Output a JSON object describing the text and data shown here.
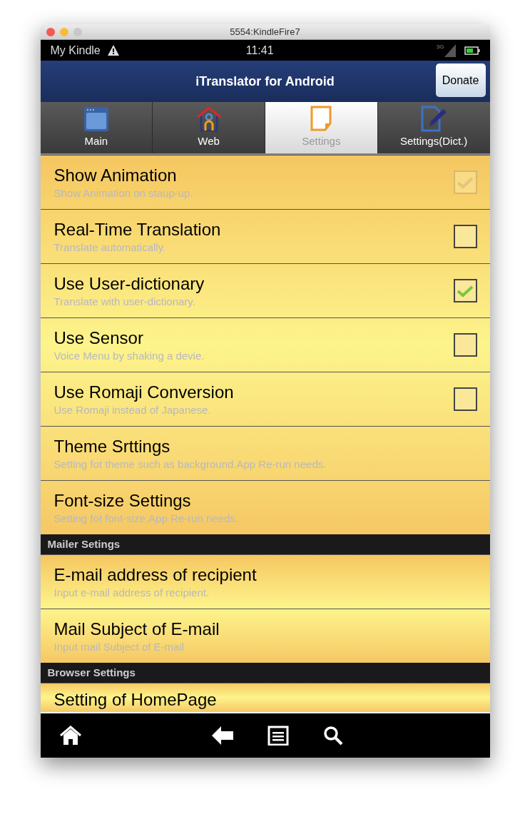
{
  "window": {
    "title": "5554:KindleFire7"
  },
  "status_bar": {
    "carrier": "My Kindle",
    "time": "11:41",
    "network": "3G"
  },
  "action_bar": {
    "title": "iTranslator for Android",
    "button": "Donate"
  },
  "tabs": [
    {
      "label": "Main",
      "selected": false
    },
    {
      "label": "Web",
      "selected": false
    },
    {
      "label": "Settings",
      "selected": true
    },
    {
      "label": "Settings(Dict.)",
      "selected": false
    }
  ],
  "sections": [
    {
      "items": [
        {
          "kind": "checkbox",
          "title": "Show Animation",
          "summary": "Show Animation on staup-up.",
          "checked": true,
          "disabled": true
        },
        {
          "kind": "checkbox",
          "title": "Real-Time Translation",
          "summary": "Translate automatically.",
          "checked": false,
          "disabled": false
        },
        {
          "kind": "checkbox",
          "title": "Use User-dictionary",
          "summary": "Translate with user-dictionary.",
          "checked": true,
          "disabled": false
        },
        {
          "kind": "checkbox",
          "title": "Use Sensor",
          "summary": "Voice Menu by shaking a devie.",
          "checked": false,
          "disabled": false
        },
        {
          "kind": "checkbox",
          "title": "Use Romaji Conversion",
          "summary": "Use Romaji instead of Japanese.",
          "checked": false,
          "disabled": false
        },
        {
          "kind": "plain",
          "title": "Theme Srttings",
          "summary": "Setting fot theme such as background.App Re-run needs."
        },
        {
          "kind": "plain",
          "title": "Font-size Settings",
          "summary": "Setting fot font-size.App Re-run needs."
        }
      ]
    },
    {
      "header": "Mailer Setings",
      "items": [
        {
          "kind": "plain",
          "title": "E-mail address of recipient",
          "summary": "Input e-mail address of recipient."
        },
        {
          "kind": "plain",
          "title": "Mail Subject of E-mail",
          "summary": "Input mail Subject of E-mail"
        }
      ]
    },
    {
      "header": "Browser Settings",
      "items": [
        {
          "kind": "partial",
          "title": "Setting of HomePage"
        }
      ]
    }
  ]
}
